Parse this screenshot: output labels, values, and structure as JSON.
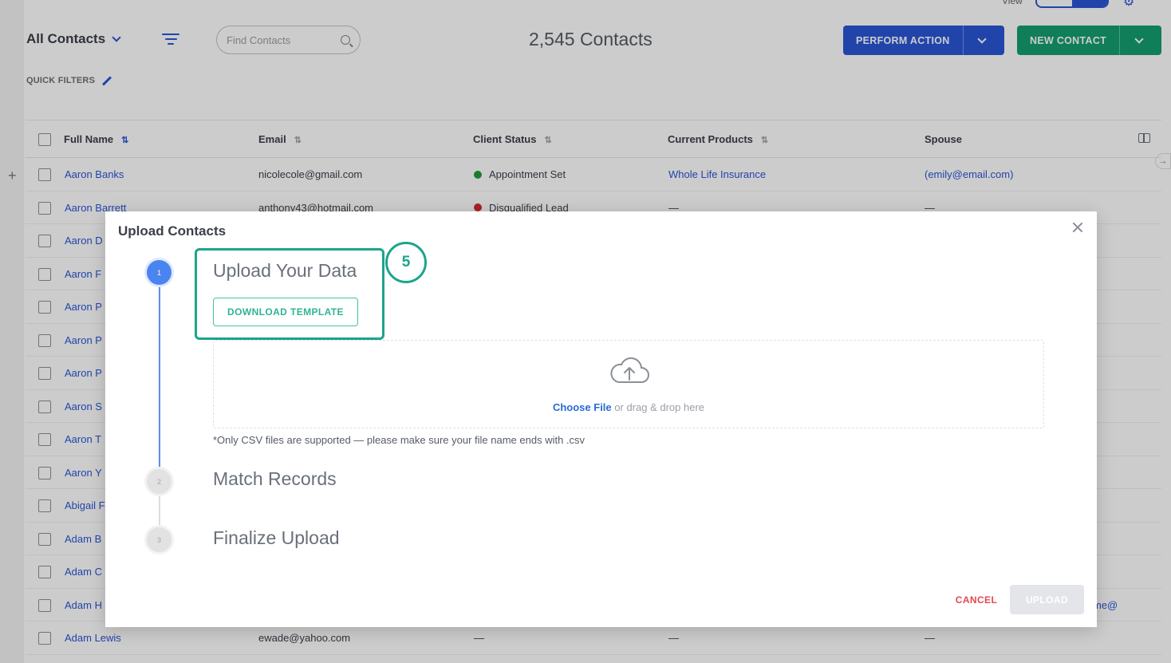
{
  "header": {
    "view_label": "View",
    "list_selector": "All Contacts",
    "search_placeholder": "Find Contacts",
    "contact_count": "2,545 Contacts",
    "perform_action_label": "PERFORM ACTION",
    "new_contact_label": "NEW CONTACT",
    "quick_filters_label": "QUICK FILTERS"
  },
  "colors": {
    "primary_blue": "#2a56d6",
    "primary_green": "#159e6e",
    "callout_teal": "#1ba58a",
    "cancel_red": "#e5484d"
  },
  "table": {
    "columns": [
      "Full Name",
      "Email",
      "Client Status",
      "Current Products",
      "Spouse"
    ],
    "rows": [
      {
        "name": "Aaron Banks",
        "email": "nicolecole@gmail.com",
        "status": "Appointment Set",
        "status_color": "#1e9e3a",
        "products": "Whole Life Insurance",
        "spouse": "(emily@email.com)"
      },
      {
        "name": "Aaron Barrett",
        "email": "anthony43@hotmail.com",
        "status": "Disqualified Lead",
        "status_color": "#d62a2a",
        "products": "—",
        "spouse": "—"
      },
      {
        "name": "Aaron D",
        "email": "",
        "status": "",
        "products": "",
        "spouse": ""
      },
      {
        "name": "Aaron F",
        "email": "",
        "status": "",
        "products": "",
        "spouse": ""
      },
      {
        "name": "Aaron P",
        "email": "",
        "status": "",
        "products": "",
        "spouse": ""
      },
      {
        "name": "Aaron P",
        "email": "",
        "status": "",
        "products": "",
        "spouse": ""
      },
      {
        "name": "Aaron P",
        "email": "",
        "status": "",
        "products": "",
        "spouse": ""
      },
      {
        "name": "Aaron S",
        "email": "",
        "status": "",
        "products": "",
        "spouse": ""
      },
      {
        "name": "Aaron T",
        "email": "",
        "status": "",
        "products": "",
        "spouse": ""
      },
      {
        "name": "Aaron Y",
        "email": "",
        "status": "",
        "products": "",
        "spouse": ""
      },
      {
        "name": "Abigail F",
        "email": "",
        "status": "",
        "products": "",
        "spouse": ""
      },
      {
        "name": "Adam B",
        "email": "",
        "status": "",
        "products": "",
        "spouse": ""
      },
      {
        "name": "Adam C",
        "email": "",
        "status": "",
        "products": "",
        "spouse": ""
      },
      {
        "name": "Adam H",
        "email": "",
        "status": "",
        "products": "",
        "spouse": "me@"
      },
      {
        "name": "Adam Lewis",
        "email": "ewade@yahoo.com",
        "status": "—",
        "products": "—",
        "spouse": "—"
      }
    ]
  },
  "modal": {
    "title": "Upload Contacts",
    "steps": [
      {
        "number": "1",
        "title": "Upload Your Data"
      },
      {
        "number": "2",
        "title": "Match Records"
      },
      {
        "number": "3",
        "title": "Finalize Upload"
      }
    ],
    "download_template_label": "DOWNLOAD TEMPLATE",
    "choose_file_label": "Choose File",
    "drag_drop_text": " or drag & drop here",
    "csv_note": "*Only CSV files are supported — please make sure your file name ends with .csv",
    "cancel_label": "CANCEL",
    "upload_label": "UPLOAD",
    "callout_number": "5"
  }
}
